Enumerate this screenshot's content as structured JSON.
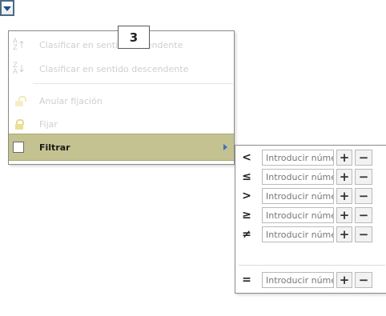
{
  "menu": {
    "items": [
      {
        "label": "Clasificar en sentido ascendente",
        "icon": "sort-ascending-icon",
        "enabled": false
      },
      {
        "label": "Clasificar en sentido descendente",
        "icon": "sort-descending-icon",
        "enabled": false
      },
      {
        "label": "Anular fijación",
        "icon": "unlock-icon",
        "enabled": false
      },
      {
        "label": "Fijar",
        "icon": "lock-icon",
        "enabled": false
      },
      {
        "label": "Filtrar",
        "icon": "checkbox",
        "enabled": true,
        "selected": true
      }
    ]
  },
  "callout": {
    "number": "3"
  },
  "filter_submenu": {
    "rows": [
      {
        "operator": "<",
        "placeholder": "Introducir número"
      },
      {
        "operator": "≤",
        "placeholder": "Introducir número"
      },
      {
        "operator": ">",
        "placeholder": "Introducir número"
      },
      {
        "operator": "≥",
        "placeholder": "Introducir número"
      },
      {
        "operator": "≠",
        "placeholder": "Introducir número"
      },
      {
        "operator": "=",
        "placeholder": "Introducir número"
      }
    ],
    "plus_label": "+",
    "minus_label": "−"
  },
  "colors": {
    "highlight": "#c4c290",
    "disabled_text": "#cfcfcf",
    "submenu_arrow": "#3b6fd1"
  }
}
